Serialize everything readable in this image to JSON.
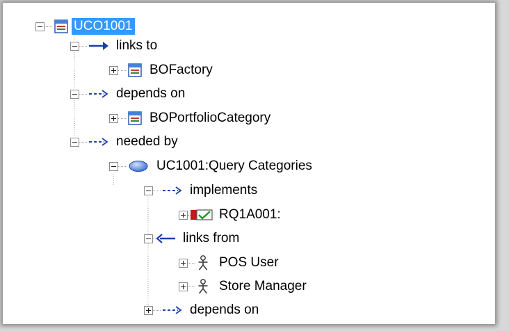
{
  "tree": {
    "root": {
      "label": "UCO1001",
      "icon": "class-element-icon",
      "selected": true,
      "expanded": true
    },
    "rel_links_to": {
      "label": "links to",
      "icon": "solid-arrow-right-icon",
      "expanded": true
    },
    "bofactory": {
      "label": "BOFactory",
      "icon": "class-element-icon",
      "expanded": false
    },
    "rel_depends_on": {
      "label": "depends on",
      "icon": "dashed-arrow-right-icon",
      "expanded": true
    },
    "boportfolio": {
      "label": "BOPortfolioCategory",
      "icon": "class-element-icon",
      "expanded": false
    },
    "rel_needed_by": {
      "label": "needed by",
      "icon": "dashed-arrow-right-icon",
      "expanded": true
    },
    "usecase": {
      "label": "UC1001:Query Categories",
      "icon": "use-case-ellipse-icon",
      "expanded": true
    },
    "rel_implements": {
      "label": "implements",
      "icon": "dashed-arrow-right-icon",
      "expanded": true
    },
    "requirement": {
      "label": "RQ1A001:",
      "icon": "requirement-check-icon",
      "expanded": false
    },
    "rel_links_from": {
      "label": "links from",
      "icon": "solid-arrow-left-icon",
      "expanded": true
    },
    "pos_user": {
      "label": "POS User",
      "icon": "actor-icon",
      "expanded": false
    },
    "store_manager": {
      "label": "Store Manager",
      "icon": "actor-icon",
      "expanded": false
    },
    "rel_depends_on_2": {
      "label": "depends on",
      "icon": "dashed-arrow-right-icon",
      "expanded": false
    }
  },
  "colors": {
    "selection": "#3399ff",
    "class_icon_stripe": "#2a5fb0",
    "use_case_fill": "#4a7fd6",
    "requirement_red": "#c0181b",
    "check_green": "#1f9a2a"
  }
}
